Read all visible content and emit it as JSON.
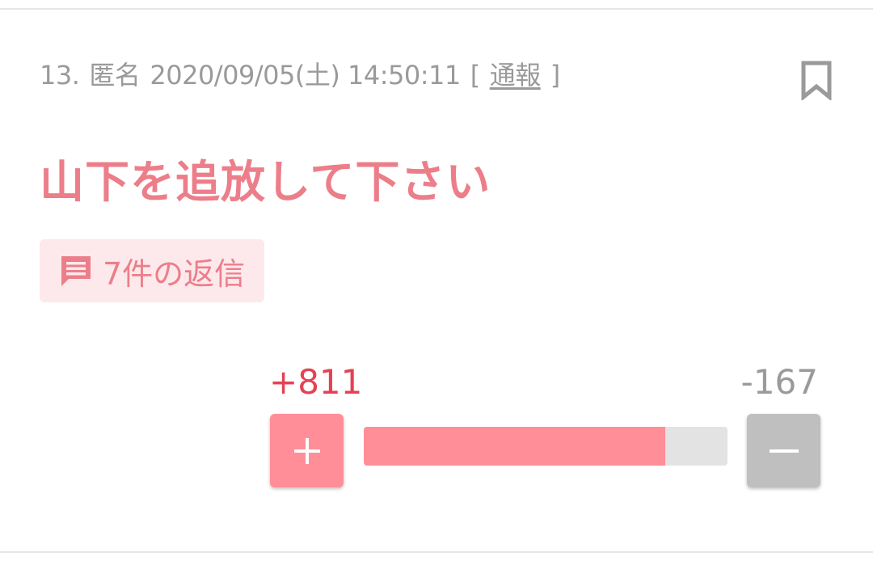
{
  "comment": {
    "number": "13.",
    "author": "匿名",
    "datetime": "2020/09/05(土) 14:50:11",
    "report": {
      "open": "[",
      "label": "通報",
      "close": "]"
    },
    "text": "山下を追放して下さい",
    "replies_label": "7件の返信"
  },
  "votes": {
    "plus_label": "+811",
    "minus_label": "-167",
    "plus": 811,
    "minus": 167,
    "plus_fraction": 0.829
  },
  "icons": {
    "bookmark": "bookmark-icon",
    "comment": "comment-icon",
    "plus": "plus-icon",
    "minus": "minus-icon"
  },
  "colors": {
    "accent": "#ec7e8a",
    "plus_red": "#e54152",
    "plus_button": "#ff8e99",
    "minus_button": "#bfbfbf",
    "replies_bg": "#fde9eb",
    "muted_text": "#9a9a9a"
  }
}
